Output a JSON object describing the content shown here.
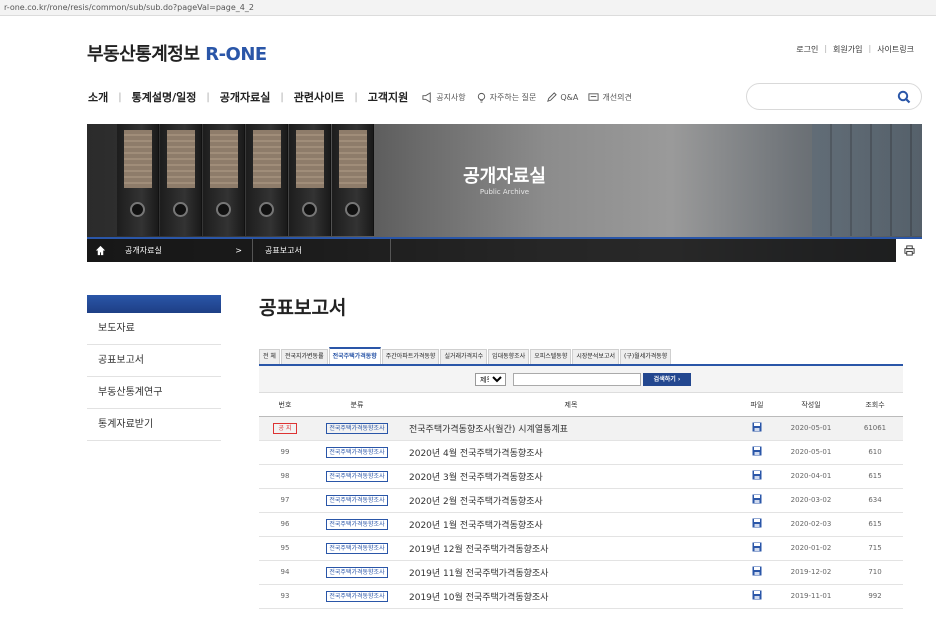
{
  "browser": {
    "url": "r-one.co.kr/rone/resis/common/sub/sub.do?pageVal=page_4_2"
  },
  "header": {
    "logo_text": "부동산통계정보",
    "logo_brand": "R-ONE",
    "util": [
      "로그인",
      "회원가입",
      "사이트링크"
    ]
  },
  "gnb": {
    "items": [
      "소개",
      "통계설명/일정",
      "공개자료실",
      "관련사이트",
      "고객지원"
    ],
    "sub_links": [
      {
        "icon": "megaphone-icon",
        "label": "공지사항"
      },
      {
        "icon": "bulb-icon",
        "label": "자주하는 질문"
      },
      {
        "icon": "pen-icon",
        "label": "Q&A"
      },
      {
        "icon": "chat-icon",
        "label": "개선의견"
      }
    ]
  },
  "hero": {
    "title": "공개자료실",
    "subtitle": "Public Archive"
  },
  "breadcrumb": {
    "level1": "공개자료실",
    "arrow": ">",
    "level2": "공표보고서"
  },
  "sidebar": {
    "items": [
      "보도자료",
      "공표보고서",
      "부동산통계연구",
      "통계자료받기"
    ]
  },
  "main": {
    "title": "공표보고서",
    "tabs": [
      "전 체",
      "전국지가변동률",
      "전국주택가격동향",
      "주간아파트가격동향",
      "실거래가격지수",
      "임대동향조사",
      "오피스텔동향",
      "시장분석보고서",
      "(구)월세가격동향"
    ],
    "active_tab": 2,
    "search": {
      "select_value": "제목",
      "button": "검색하기 ›"
    },
    "columns": [
      "번호",
      "분류",
      "제목",
      "파일",
      "작성일",
      "조회수"
    ],
    "rows": [
      {
        "no": "공 지",
        "cat": "전국주택가격동향조사",
        "title": "전국주택가격동향조사(월간) 시계열통계표",
        "date": "2020-05-01",
        "views": "61061",
        "notice": true
      },
      {
        "no": "99",
        "cat": "전국주택가격동향조사",
        "title": "2020년 4월 전국주택가격동향조사",
        "date": "2020-05-01",
        "views": "610"
      },
      {
        "no": "98",
        "cat": "전국주택가격동향조사",
        "title": "2020년 3월 전국주택가격동향조사",
        "date": "2020-04-01",
        "views": "615"
      },
      {
        "no": "97",
        "cat": "전국주택가격동향조사",
        "title": "2020년 2월 전국주택가격동향조사",
        "date": "2020-03-02",
        "views": "634"
      },
      {
        "no": "96",
        "cat": "전국주택가격동향조사",
        "title": "2020년 1월 전국주택가격동향조사",
        "date": "2020-02-03",
        "views": "615"
      },
      {
        "no": "95",
        "cat": "전국주택가격동향조사",
        "title": "2019년 12월 전국주택가격동향조사",
        "date": "2020-01-02",
        "views": "715"
      },
      {
        "no": "94",
        "cat": "전국주택가격동향조사",
        "title": "2019년 11월 전국주택가격동향조사",
        "date": "2019-12-02",
        "views": "710"
      },
      {
        "no": "93",
        "cat": "전국주택가격동향조사",
        "title": "2019년 10월 전국주택가격동향조사",
        "date": "2019-11-01",
        "views": "992"
      }
    ]
  },
  "colors": {
    "brand_blue": "#2a56a8",
    "notice_red": "#dd3333"
  }
}
